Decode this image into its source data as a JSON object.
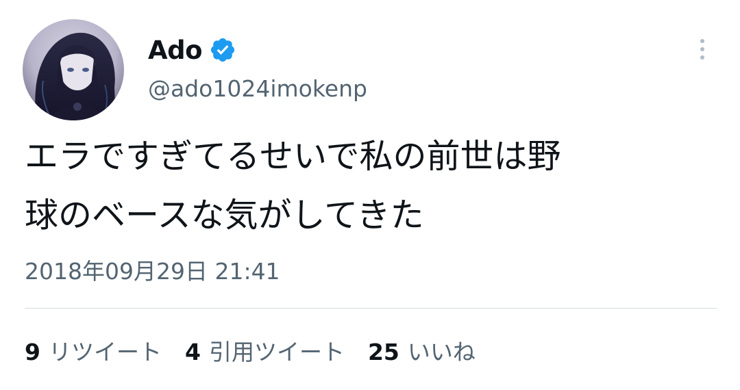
{
  "user": {
    "display_name": "Ado",
    "handle": "@ado1024imokenp",
    "verified": true,
    "avatar_icon": "avatar-icon",
    "verified_color": "#1d9bf0"
  },
  "tweet": {
    "text_line1": "エラですぎてるせいで私の前世は野",
    "text_line2": "球のベースな気がしてきた",
    "timestamp": "2018年09月29日 21:41"
  },
  "stats": {
    "retweets": {
      "count": "9",
      "label": "リツイート"
    },
    "quotes": {
      "count": "4",
      "label": "引用ツイート"
    },
    "likes": {
      "count": "25",
      "label": "いいね"
    }
  },
  "icons": {
    "more": "more-vertical-icon",
    "verified": "verified-badge-icon"
  }
}
